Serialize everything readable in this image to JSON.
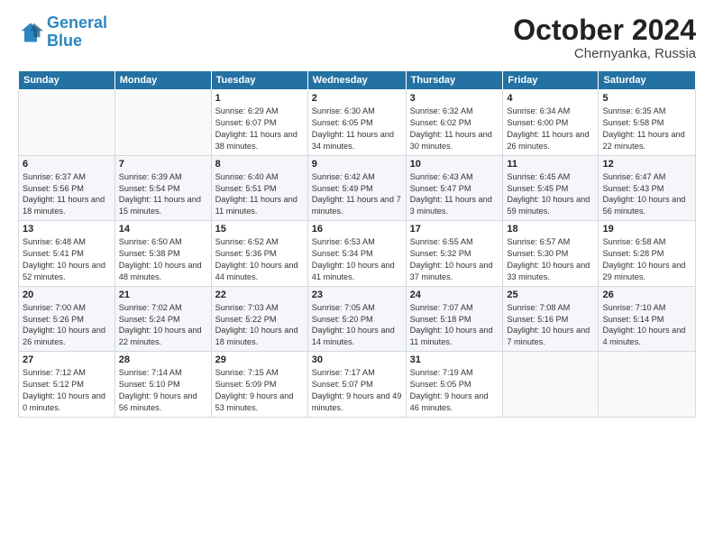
{
  "header": {
    "logo_line1": "General",
    "logo_line2": "Blue",
    "month": "October 2024",
    "location": "Chernyanka, Russia"
  },
  "weekdays": [
    "Sunday",
    "Monday",
    "Tuesday",
    "Wednesday",
    "Thursday",
    "Friday",
    "Saturday"
  ],
  "weeks": [
    [
      {
        "day": "",
        "info": ""
      },
      {
        "day": "",
        "info": ""
      },
      {
        "day": "1",
        "info": "Sunrise: 6:29 AM\nSunset: 6:07 PM\nDaylight: 11 hours and 38 minutes."
      },
      {
        "day": "2",
        "info": "Sunrise: 6:30 AM\nSunset: 6:05 PM\nDaylight: 11 hours and 34 minutes."
      },
      {
        "day": "3",
        "info": "Sunrise: 6:32 AM\nSunset: 6:02 PM\nDaylight: 11 hours and 30 minutes."
      },
      {
        "day": "4",
        "info": "Sunrise: 6:34 AM\nSunset: 6:00 PM\nDaylight: 11 hours and 26 minutes."
      },
      {
        "day": "5",
        "info": "Sunrise: 6:35 AM\nSunset: 5:58 PM\nDaylight: 11 hours and 22 minutes."
      }
    ],
    [
      {
        "day": "6",
        "info": "Sunrise: 6:37 AM\nSunset: 5:56 PM\nDaylight: 11 hours and 18 minutes."
      },
      {
        "day": "7",
        "info": "Sunrise: 6:39 AM\nSunset: 5:54 PM\nDaylight: 11 hours and 15 minutes."
      },
      {
        "day": "8",
        "info": "Sunrise: 6:40 AM\nSunset: 5:51 PM\nDaylight: 11 hours and 11 minutes."
      },
      {
        "day": "9",
        "info": "Sunrise: 6:42 AM\nSunset: 5:49 PM\nDaylight: 11 hours and 7 minutes."
      },
      {
        "day": "10",
        "info": "Sunrise: 6:43 AM\nSunset: 5:47 PM\nDaylight: 11 hours and 3 minutes."
      },
      {
        "day": "11",
        "info": "Sunrise: 6:45 AM\nSunset: 5:45 PM\nDaylight: 10 hours and 59 minutes."
      },
      {
        "day": "12",
        "info": "Sunrise: 6:47 AM\nSunset: 5:43 PM\nDaylight: 10 hours and 56 minutes."
      }
    ],
    [
      {
        "day": "13",
        "info": "Sunrise: 6:48 AM\nSunset: 5:41 PM\nDaylight: 10 hours and 52 minutes."
      },
      {
        "day": "14",
        "info": "Sunrise: 6:50 AM\nSunset: 5:38 PM\nDaylight: 10 hours and 48 minutes."
      },
      {
        "day": "15",
        "info": "Sunrise: 6:52 AM\nSunset: 5:36 PM\nDaylight: 10 hours and 44 minutes."
      },
      {
        "day": "16",
        "info": "Sunrise: 6:53 AM\nSunset: 5:34 PM\nDaylight: 10 hours and 41 minutes."
      },
      {
        "day": "17",
        "info": "Sunrise: 6:55 AM\nSunset: 5:32 PM\nDaylight: 10 hours and 37 minutes."
      },
      {
        "day": "18",
        "info": "Sunrise: 6:57 AM\nSunset: 5:30 PM\nDaylight: 10 hours and 33 minutes."
      },
      {
        "day": "19",
        "info": "Sunrise: 6:58 AM\nSunset: 5:28 PM\nDaylight: 10 hours and 29 minutes."
      }
    ],
    [
      {
        "day": "20",
        "info": "Sunrise: 7:00 AM\nSunset: 5:26 PM\nDaylight: 10 hours and 26 minutes."
      },
      {
        "day": "21",
        "info": "Sunrise: 7:02 AM\nSunset: 5:24 PM\nDaylight: 10 hours and 22 minutes."
      },
      {
        "day": "22",
        "info": "Sunrise: 7:03 AM\nSunset: 5:22 PM\nDaylight: 10 hours and 18 minutes."
      },
      {
        "day": "23",
        "info": "Sunrise: 7:05 AM\nSunset: 5:20 PM\nDaylight: 10 hours and 14 minutes."
      },
      {
        "day": "24",
        "info": "Sunrise: 7:07 AM\nSunset: 5:18 PM\nDaylight: 10 hours and 11 minutes."
      },
      {
        "day": "25",
        "info": "Sunrise: 7:08 AM\nSunset: 5:16 PM\nDaylight: 10 hours and 7 minutes."
      },
      {
        "day": "26",
        "info": "Sunrise: 7:10 AM\nSunset: 5:14 PM\nDaylight: 10 hours and 4 minutes."
      }
    ],
    [
      {
        "day": "27",
        "info": "Sunrise: 7:12 AM\nSunset: 5:12 PM\nDaylight: 10 hours and 0 minutes."
      },
      {
        "day": "28",
        "info": "Sunrise: 7:14 AM\nSunset: 5:10 PM\nDaylight: 9 hours and 56 minutes."
      },
      {
        "day": "29",
        "info": "Sunrise: 7:15 AM\nSunset: 5:09 PM\nDaylight: 9 hours and 53 minutes."
      },
      {
        "day": "30",
        "info": "Sunrise: 7:17 AM\nSunset: 5:07 PM\nDaylight: 9 hours and 49 minutes."
      },
      {
        "day": "31",
        "info": "Sunrise: 7:19 AM\nSunset: 5:05 PM\nDaylight: 9 hours and 46 minutes."
      },
      {
        "day": "",
        "info": ""
      },
      {
        "day": "",
        "info": ""
      }
    ]
  ]
}
